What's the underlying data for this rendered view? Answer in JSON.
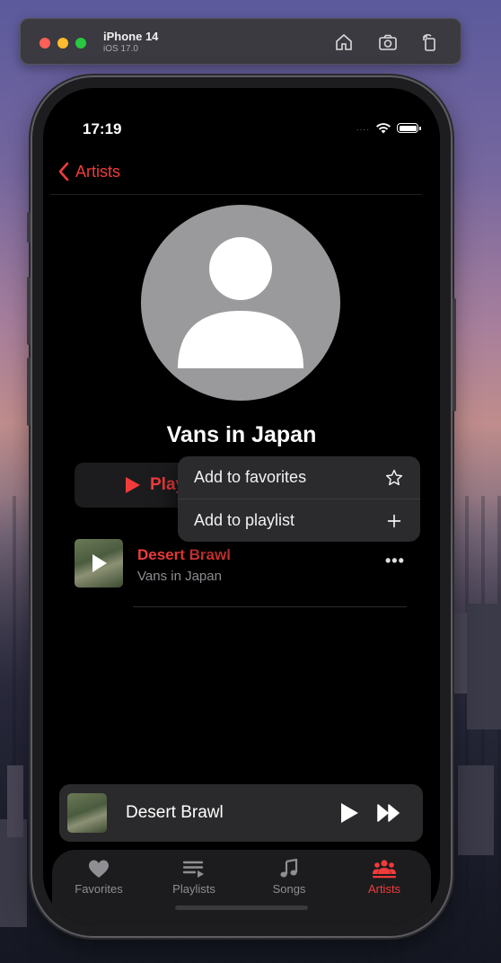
{
  "simulator": {
    "device_name": "iPhone 14",
    "os_version": "iOS 17.0",
    "toolbar_icons": [
      "home-icon",
      "screenshot-icon",
      "rotate-icon"
    ]
  },
  "status_bar": {
    "time": "17:19",
    "signal": "....",
    "icons": [
      "wifi-icon",
      "battery-icon"
    ]
  },
  "nav": {
    "back_label": "Artists"
  },
  "artist": {
    "name": "Vans in Japan"
  },
  "play_button": {
    "label": "Play"
  },
  "context_menu": {
    "items": [
      {
        "label": "Add to favorites",
        "icon": "star-icon"
      },
      {
        "label": "Add to playlist",
        "icon": "plus-icon"
      }
    ]
  },
  "tracks": [
    {
      "title": "Desert Brawl",
      "artist": "Vans in Japan",
      "more": "•••"
    }
  ],
  "mini_player": {
    "title": "Desert Brawl"
  },
  "tabs": [
    {
      "label": "Favorites",
      "icon": "heart-icon"
    },
    {
      "label": "Playlists",
      "icon": "playlist-icon"
    },
    {
      "label": "Songs",
      "icon": "music-note-icon"
    },
    {
      "label": "Artists",
      "icon": "people-icon",
      "active": true
    }
  ],
  "colors": {
    "accent": "#f23b3b",
    "background": "#000000",
    "surface": "#1c1c1e",
    "menu": "#2b2b2d"
  }
}
